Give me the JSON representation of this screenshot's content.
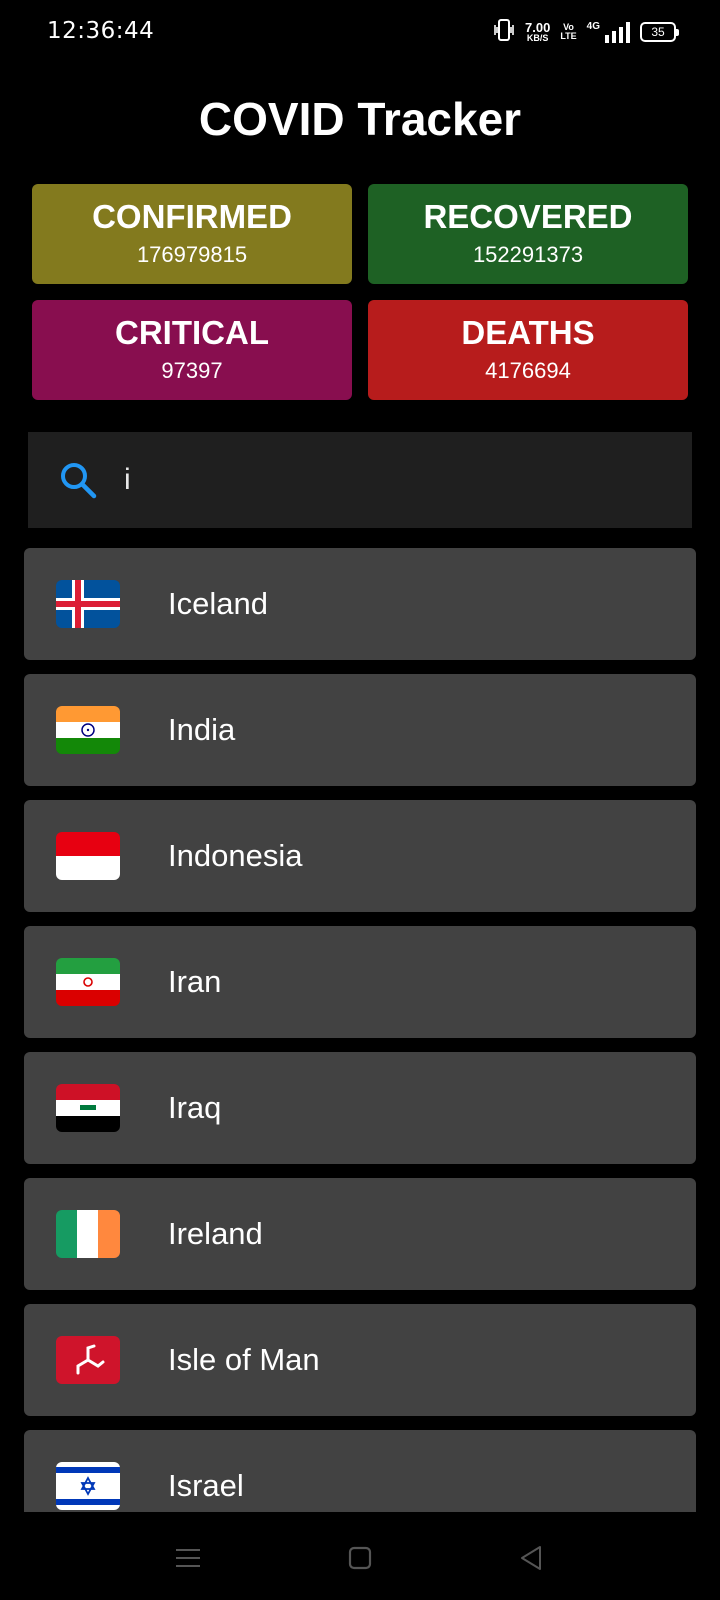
{
  "status_bar": {
    "time": "12:36:44",
    "net_speed_value": "7.00",
    "net_speed_unit": "KB/S",
    "volte_top": "Vo",
    "volte_bottom": "LTE",
    "network": "4G",
    "battery": "35",
    "icons": [
      "vibrate-icon",
      "signal-icon",
      "battery-icon"
    ]
  },
  "app": {
    "title": "COVID Tracker"
  },
  "stats": {
    "confirmed": {
      "label": "CONFIRMED",
      "value": "176979815",
      "color": "#837a1e"
    },
    "recovered": {
      "label": "RECOVERED",
      "value": "152291373",
      "color": "#1e6124"
    },
    "critical": {
      "label": "CRITICAL",
      "value": "97397",
      "color": "#880e4f"
    },
    "deaths": {
      "label": "DEATHS",
      "value": "4176694",
      "color": "#b71c1c"
    }
  },
  "search": {
    "value": "i",
    "icon": "search-icon",
    "icon_color": "#2196f3"
  },
  "countries": [
    {
      "name": "Iceland"
    },
    {
      "name": "India"
    },
    {
      "name": "Indonesia"
    },
    {
      "name": "Iran"
    },
    {
      "name": "Iraq"
    },
    {
      "name": "Ireland"
    },
    {
      "name": "Isle of Man"
    },
    {
      "name": "Israel"
    }
  ],
  "nav_bar": {
    "icons": [
      "menu-icon",
      "home-icon",
      "back-icon"
    ]
  }
}
